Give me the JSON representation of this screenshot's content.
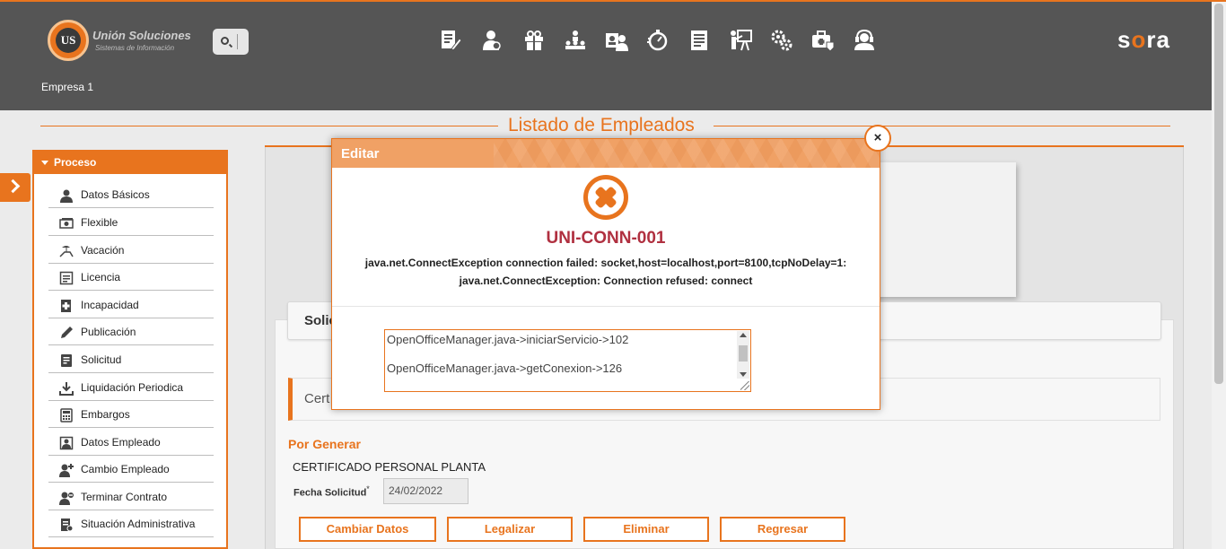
{
  "header": {
    "logo_title": "Unión Soluciones",
    "logo_subtitle": "Sistemas de Información",
    "logo_mark": "US",
    "brand": "sora",
    "company": "Empresa 1",
    "nav_icons": [
      "document-edit-icon",
      "employee-icon",
      "gift-icon",
      "hierarchy-icon",
      "id-card-icon",
      "stopwatch-icon",
      "report-icon",
      "presentation-icon",
      "gears-icon",
      "medical-briefcase-icon",
      "support-agent-icon"
    ]
  },
  "page": {
    "title": "Listado de Empleados"
  },
  "sidebar": {
    "section": "Proceso",
    "items": [
      {
        "label": "Datos Básicos",
        "icon": "user-icon"
      },
      {
        "label": "Flexible",
        "icon": "money-icon"
      },
      {
        "label": "Vacación",
        "icon": "beach-chair-icon"
      },
      {
        "label": "Licencia",
        "icon": "license-icon"
      },
      {
        "label": "Incapacidad",
        "icon": "medical-doc-icon"
      },
      {
        "label": "Publicación",
        "icon": "pen-icon"
      },
      {
        "label": "Solicitud",
        "icon": "request-icon"
      },
      {
        "label": "Liquidación Periodica",
        "icon": "download-icon"
      },
      {
        "label": "Embargos",
        "icon": "calculator-icon"
      },
      {
        "label": "Datos Empleado",
        "icon": "id-badge-icon"
      },
      {
        "label": "Cambio Empleado",
        "icon": "user-change-icon"
      },
      {
        "label": "Terminar Contrato",
        "icon": "user-remove-icon"
      },
      {
        "label": "Situación Administrativa",
        "icon": "admin-doc-icon"
      }
    ]
  },
  "main": {
    "soli_label": "Solic",
    "cert_label": "Cert",
    "section_title": "Por Generar",
    "certificate_name": "CERTIFICADO PERSONAL PLANTA",
    "fecha_label": "Fecha Solicitud",
    "fecha_required": "*",
    "fecha_value": "24/02/2022",
    "buttons": {
      "cambiar": "Cambiar Datos",
      "legalizar": "Legalizar",
      "eliminar": "Eliminar",
      "regresar": "Regresar"
    }
  },
  "modal": {
    "title": "Editar",
    "close": "×",
    "error_code": "UNI-CONN-001",
    "error_line1": "java.net.ConnectException connection failed: socket,host=localhost,port=8100,tcpNoDelay=1:",
    "error_line2": "java.net.ConnectException: Connection refused: connect",
    "trace": [
      "OpenOfficeManager.java->iniciarServicio->102",
      "OpenOfficeManager.java->getConexion->126"
    ]
  },
  "colors": {
    "accent": "#e8741e",
    "header_bg": "#555555",
    "error_code": "#b03040"
  }
}
